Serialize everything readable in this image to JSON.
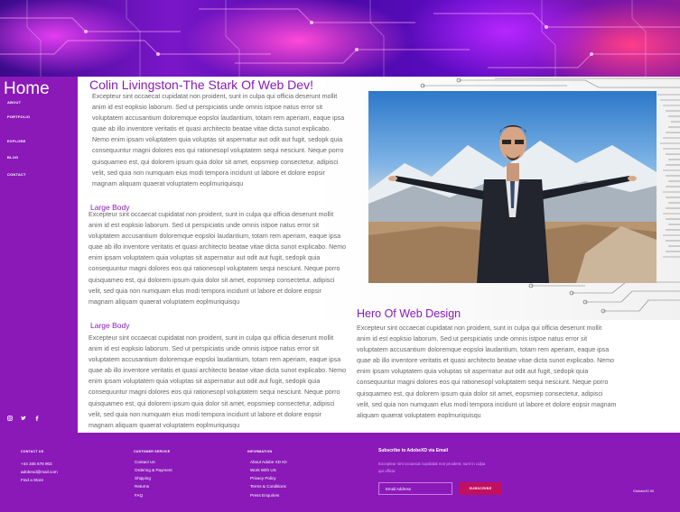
{
  "sidebar": {
    "title": "Home",
    "items": [
      {
        "label": "ABOUT"
      },
      {
        "label": "PORTFOLIO"
      },
      {
        "label": "EXPLORE"
      },
      {
        "label": "BLOG"
      },
      {
        "label": "CONTACT"
      }
    ],
    "social": [
      "instagram-icon",
      "twitter-icon",
      "facebook-icon"
    ]
  },
  "main": {
    "headline": "Colin Livingston-The Stark Of Web Dev!",
    "intro": "Excepteur sint occaecat cupidatat non proident, sunt in culpa qui officia deserunt mollit anim id est eopksio laborum. Sed ut perspiciatis unde omnis istpoe natus error sit voluptatem accusantium doloremque eopsloi laudantium, totam rem aperiam, eaque ipsa quae ab illo inventore veritatis et quasi architecto beatae vitae dicta sunot explicabo. Nemo enim ipsam voluptatem quia voluptas sit aspernatur aut odit aut fugit, sedopk quia consequuntur magni dolores eos qui rationesopl voluptatem sequi nesciunt. Neque porro quisquameo est, qui dolorem ipsum quia dolor sit amet, eopsmiep consectetur, adipisci velit, sed quia non numquam eius modi tempora incidunt ut labore et dolore eopsir magnam aliquam quaerat voluptatem eoplmuriquisqu",
    "section1": {
      "title": "Large Body",
      "text": "Excepteur sint occaecat cupidatat non proident, sunt in culpa qui officia deserunt mollit anim id est eopksio laborum. Sed ut perspiciatis unde omnis istpoe natus error sit voluptatem accusantium doloremque eopsloi laudantium, totam rem aperiam, eaque ipsa quae ab illo inventore veritatis et quasi architecto beatae vitae dicta sunot explicabo. Nemo enim ipsam voluptatem quia voluptas sit aspernatur aut odit aut fugit, sedopk quia consequuntur magni dolores eos qui rationesopl voluptatem sequi nesciunt. Neque porro quisquameo est, qui dolorem ipsum quia dolor sit amet, eopsmiep consectetur, adipisci velit, sed quia non numquam elus modi tempora incidunt ut labore et dolore eopsir magnam aliquam quaerat voluptatem eoplmuriquisqu"
    },
    "section2": {
      "title": "Large Body",
      "text": "Excepteur sint occaecat cupidatat non proident, sunt in culpa qui officia deserunt mollit anim id est eopksio laborum. Sed ut perspiciatis unde omnis istpoe natus error sit voluptatem accusantium doloremque eopsloi laudantium, totam rem aperiam, eaque ipsa quae ab illo inventore veritatis et quasi architecto beatae vitae dicta sunot explicabo. Nemo enim ipsam voluptatem quia voluptas sit aspernatur aut odit aut fugit, sedopk quia consequuntur magni dolores eos qui rationesopl voluptatem sequi nesciunt. Neque porro quisquameo est, qui dolorem ipsum quia dolor sit amet, eopsmiep consectetur, adipisci velit, sed quia non numquam eius modi tempora incidunt ut labore et dolore eopsir magnam aliquam quaerat voluptatem eoplmuriquisqu"
    },
    "hero": {
      "title": "Hero Of Web Design",
      "text": "Excepteur sint occaecat cupidatat non proident, sunt in culpa qui officia deserunt mollit anim id est eopksio laborum. Sed ut perspiciatis unde omnis istpoe natus error sit voluptatem accusantium doloremque eopsloi laudantium, totam rem aperiam, eaque ipsa quae ab illo inventore veritatis et quasi architecto beatae vitae dicta sunot explicabo. Nemo enim ipsam voluptatem quia voluptas sit aspernatur aut odit aut fugit, sedopk quia consequuntur magni dolores eos qui rationesopl voluptatem sequi nesciunt. Neque porro quisquameo est, qui dolorem ipsum quia dolor sit amet, eopsmiep consectetur, adipisci velit, sed quia non numquam elus modi tempora incidunt ut labore et dolore eopsir magnam aliquam quaerat voluptatem eoplmuriquisqu"
    }
  },
  "footer": {
    "contact": {
      "heading": "CONTACT US",
      "phone": "+44 345 678 903",
      "email": "adobexd@mail.com",
      "store": "Find a Store"
    },
    "customer_service": {
      "heading": "CUSTOMER SERVICE",
      "links": [
        "Contact Us",
        "Ordering & Payment",
        "Shipping",
        "Returns",
        "FAQ"
      ]
    },
    "information": {
      "heading": "INFORMATION",
      "links": [
        "About Adobe XD Kit",
        "Work With US",
        "Privacy Policy",
        "Terms & Conditions",
        "Press Enquiries"
      ]
    },
    "subscribe": {
      "title": "Subscribe to AdobeXD via Email",
      "text": "Excepteur sint occaecat cupidatat non proident, sunt in culpa qui officia",
      "placeholder": "Email Address",
      "button": "SUBSCRIBE"
    },
    "copyright": "©AdobeXD Kit"
  },
  "colors": {
    "accent": "#8a19b8",
    "subscribe_button": "#c0105f"
  }
}
